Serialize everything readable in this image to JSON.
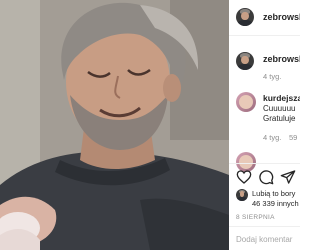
{
  "post": {
    "username": "zebrowski",
    "caption_author": "zebrowski",
    "caption_age": "4 tyg."
  },
  "comments": [
    {
      "username": "kurdejsza",
      "line1": "Cuuuuuu",
      "line2": "Gratuluje",
      "age": "4 tyg.",
      "likes": "59"
    }
  ],
  "likes": {
    "line1": "Lubią to bory",
    "line2": "46 339 innych"
  },
  "date": "8 SIERPNIA",
  "comment_placeholder": "Dodaj komentar",
  "colors": {
    "separator": "#efefef",
    "muted": "#8e8e8e"
  },
  "icons": [
    "heart-icon",
    "comment-icon",
    "share-icon"
  ]
}
